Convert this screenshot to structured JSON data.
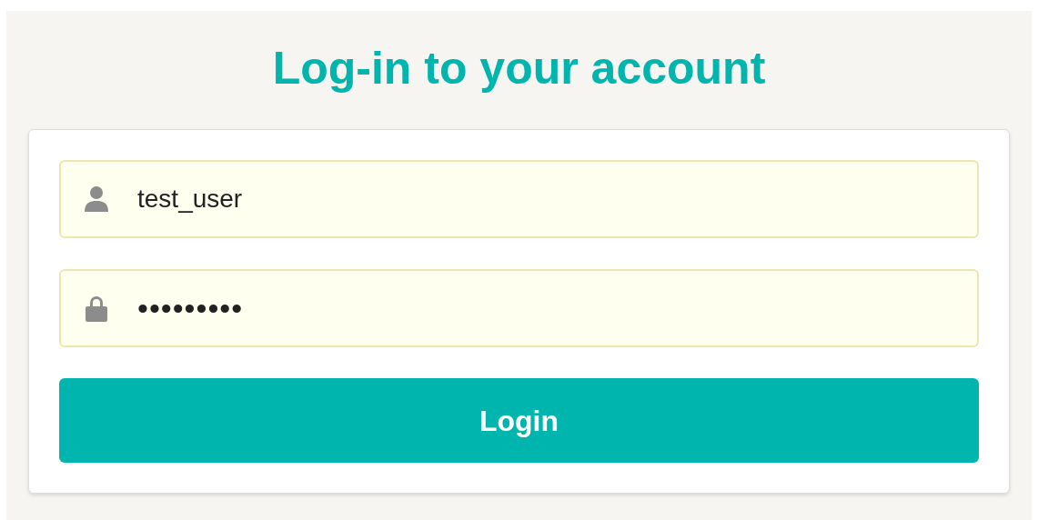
{
  "title": "Log-in to your account",
  "fields": [
    {
      "kind": "user",
      "value": "test_user"
    },
    {
      "kind": "password",
      "value": "•••••••••"
    }
  ],
  "button": "Login"
}
